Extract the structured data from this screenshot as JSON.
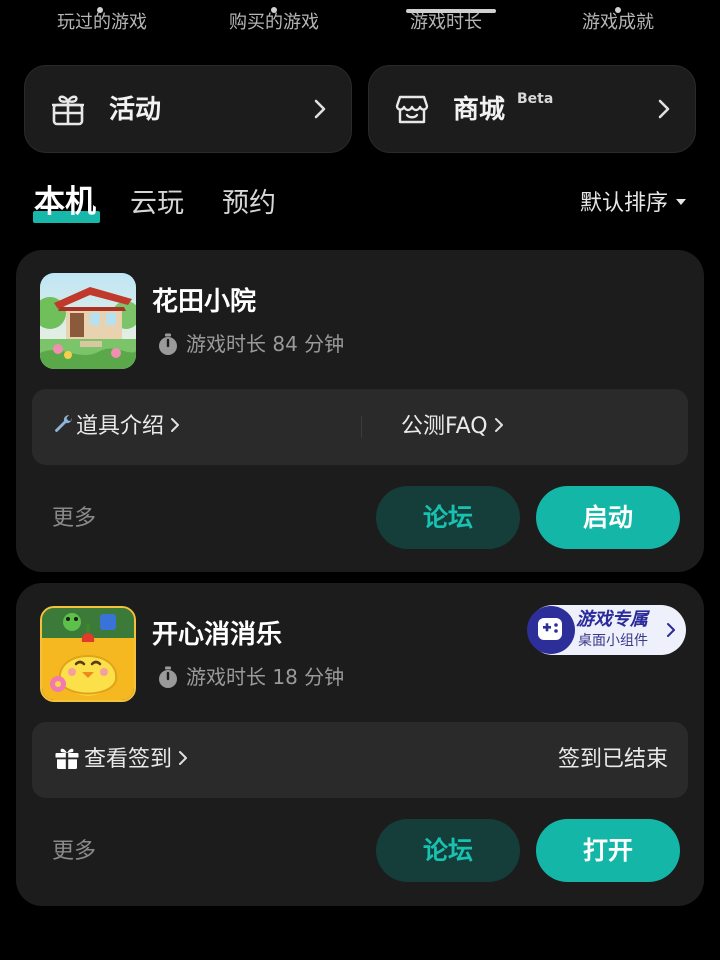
{
  "stats": {
    "played_games": "玩过的游戏",
    "purchased_games": "购买的游戏",
    "play_duration": "游戏时长",
    "achievements": "游戏成就"
  },
  "quick_cards": {
    "activity_label": "活动",
    "store_label": "商城",
    "store_badge": "Beta"
  },
  "tabs": {
    "local": "本机",
    "cloud": "云玩",
    "reserve": "预约",
    "sort_label": "默认排序"
  },
  "games": [
    {
      "name": "花田小院",
      "playtime": "游戏时长 84 分钟",
      "info_left": "道具介绍",
      "info_right": "公测FAQ",
      "more": "更多",
      "forum_button": "论坛",
      "primary_button": "启动"
    },
    {
      "name": "开心消消乐",
      "playtime": "游戏时长 18 分钟",
      "info_left": "查看签到",
      "info_right": "签到已结束",
      "more": "更多",
      "forum_button": "论坛",
      "primary_button": "打开",
      "widget_title": "游戏专属",
      "widget_sub": "桌面小组件"
    }
  ],
  "colors": {
    "accent": "#14b6a8",
    "forum_bg": "#153d3a",
    "card_bg": "#1c1c1c"
  }
}
